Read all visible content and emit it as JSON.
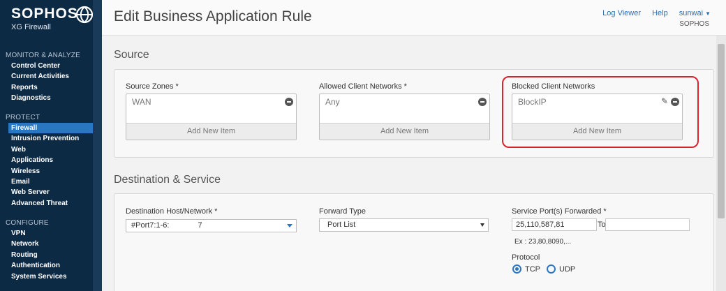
{
  "brand": {
    "name": "SOPHOS",
    "product": "XG Firewall"
  },
  "sidebar": {
    "sections": [
      {
        "heading": "MONITOR & ANALYZE",
        "items": [
          "Control Center",
          "Current Activities",
          "Reports",
          "Diagnostics"
        ]
      },
      {
        "heading": "PROTECT",
        "items": [
          "Firewall",
          "Intrusion Prevention",
          "Web",
          "Applications",
          "Wireless",
          "Email",
          "Web Server",
          "Advanced Threat"
        ]
      },
      {
        "heading": "CONFIGURE",
        "items": [
          "VPN",
          "Network",
          "Routing",
          "Authentication",
          "System Services"
        ]
      }
    ],
    "active_item": "Firewall"
  },
  "header": {
    "title": "Edit Business Application Rule",
    "log_viewer": "Log Viewer",
    "help": "Help",
    "user": "sunwai",
    "org": "SOPHOS"
  },
  "source": {
    "title": "Source",
    "zones": {
      "label": "Source Zones *",
      "items": [
        "WAN"
      ],
      "add": "Add New Item"
    },
    "allowed": {
      "label": "Allowed Client Networks *",
      "items": [
        "Any"
      ],
      "add": "Add New Item"
    },
    "blocked": {
      "label": "Blocked Client Networks",
      "items": [
        "BlockIP"
      ],
      "add": "Add New Item"
    }
  },
  "destination": {
    "title": "Destination & Service",
    "host": {
      "label": "Destination Host/Network *",
      "value": "#Port7:1-6:",
      "value_suffix": "7"
    },
    "forward_type": {
      "label": "Forward Type",
      "value": "Port List"
    },
    "service_port": {
      "label": "Service Port(s) Forwarded *",
      "value": "25,110,587,81",
      "to_label": "To",
      "to_value": "",
      "example": "Ex : 23,80,8090,..."
    },
    "protocol": {
      "label": "Protocol",
      "options": [
        "TCP",
        "UDP"
      ],
      "selected": "TCP"
    }
  },
  "colors": {
    "sidebar_bg": "#0d2a45",
    "active_nav": "#2a76c0",
    "highlight": "#d9232e",
    "link": "#2a6fb5"
  },
  "icons": {
    "logo": "sophos-globe-icon",
    "remove": "minus-circle-icon",
    "edit": "pencil-icon",
    "dropdown": "chevron-down-icon"
  }
}
